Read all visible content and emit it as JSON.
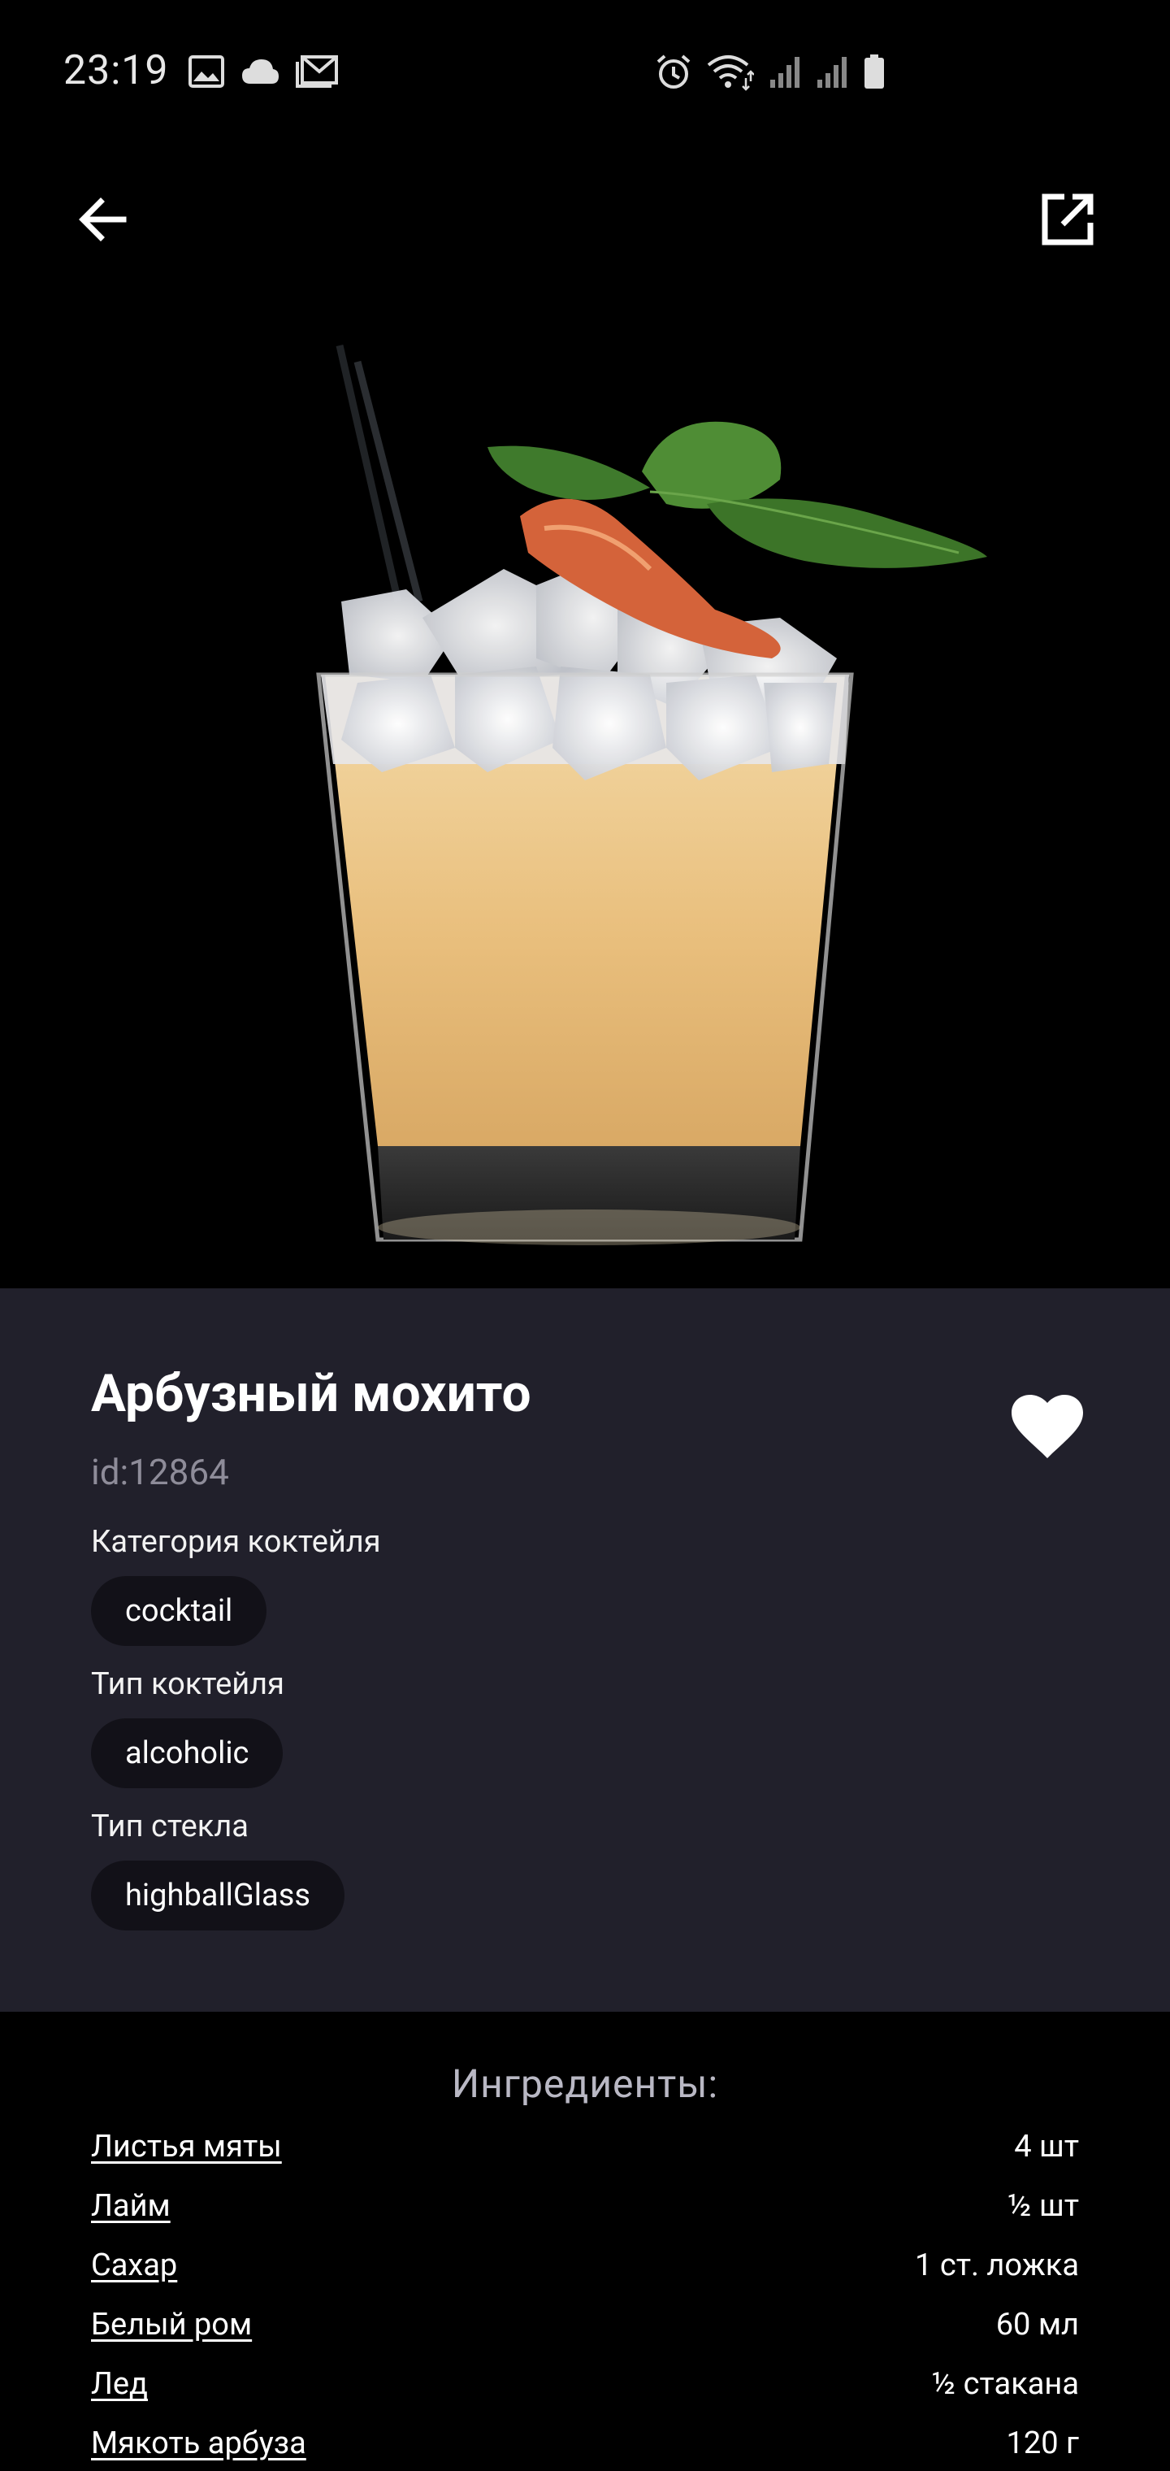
{
  "status_bar": {
    "time": "23:19",
    "left_icons": [
      "image-icon",
      "cloud-icon",
      "gmail-icon"
    ],
    "right_icons": [
      "alarm-icon",
      "wifi-icon",
      "signal-icon",
      "signal-icon",
      "battery-icon"
    ]
  },
  "toolbar": {
    "back_icon": "arrow-back-icon",
    "share_icon": "open-in-new-icon"
  },
  "cocktail": {
    "name": "Арбузный мохито",
    "id": "id:12864",
    "favorite_icon": "heart-icon"
  },
  "fields": {
    "category_label": "Категория коктейля",
    "category_value": "cocktail",
    "type_label": "Тип коктейля",
    "type_value": "alcoholic",
    "glass_label": "Тип стекла",
    "glass_value": "highballGlass"
  },
  "ingredients": {
    "title": "Ингредиенты:",
    "items": [
      {
        "name": "Листья мяты",
        "amount": "4 шт"
      },
      {
        "name": "Лайм",
        "amount": "½ шт"
      },
      {
        "name": "Сахар",
        "amount": "1 ст. ложка"
      },
      {
        "name": "Белый ром",
        "amount": "60 мл"
      },
      {
        "name": "Лед",
        "amount": "½ стакана"
      },
      {
        "name": "Мякоть арбуза",
        "amount": "120 г"
      }
    ]
  },
  "colors": {
    "card_background": "#21202b",
    "chip_background": "#121118",
    "background": "#000000"
  }
}
